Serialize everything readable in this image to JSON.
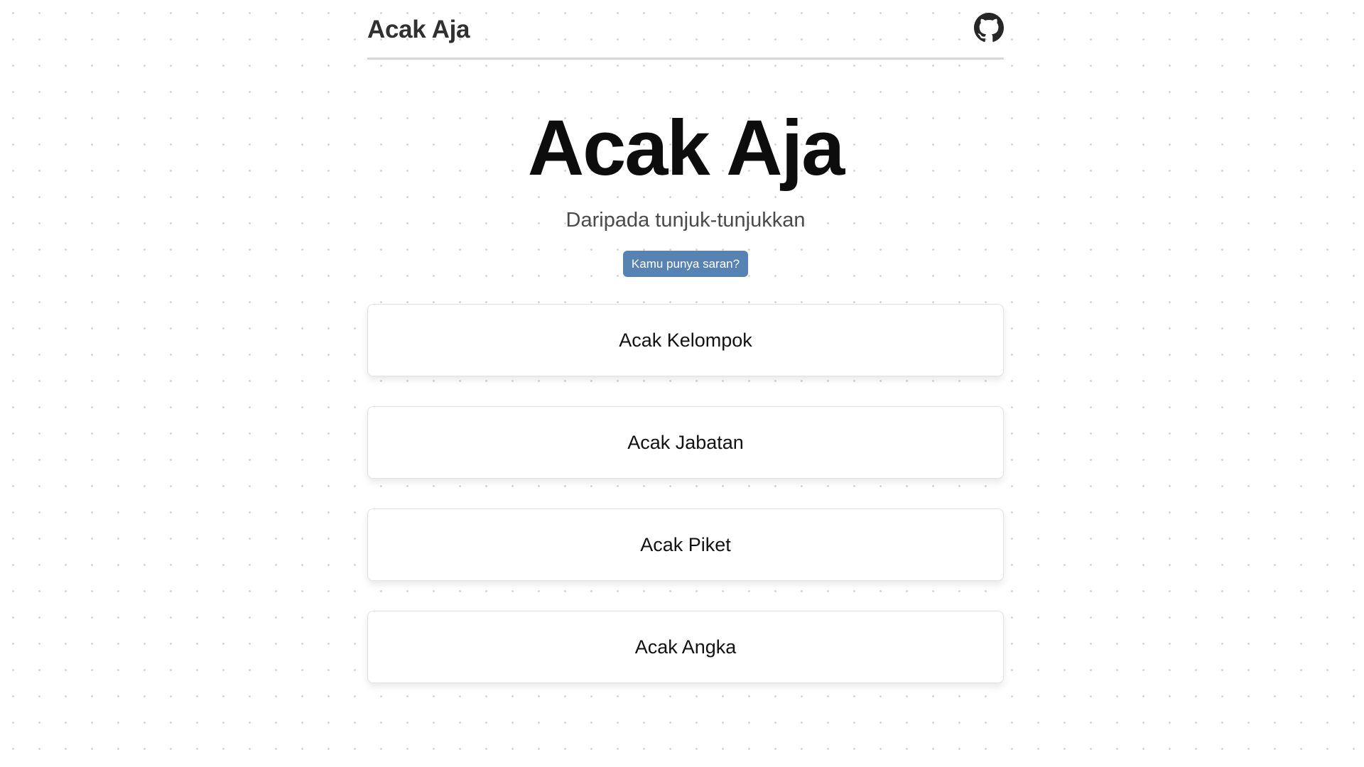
{
  "navbar": {
    "brand": "Acak Aja",
    "github_icon": "github-icon"
  },
  "hero": {
    "title": "Acak Aja",
    "subtitle": "Daripada tunjuk-tunjukkan",
    "suggest_button": "Kamu punya saran?"
  },
  "menu": {
    "items": [
      {
        "label": "Acak Kelompok"
      },
      {
        "label": "Acak Jabatan"
      },
      {
        "label": "Acak Piket"
      },
      {
        "label": "Acak Angka"
      }
    ]
  },
  "colors": {
    "accent": "#5783b3",
    "background": "#ffffff",
    "dots": "#d2d2d2"
  }
}
